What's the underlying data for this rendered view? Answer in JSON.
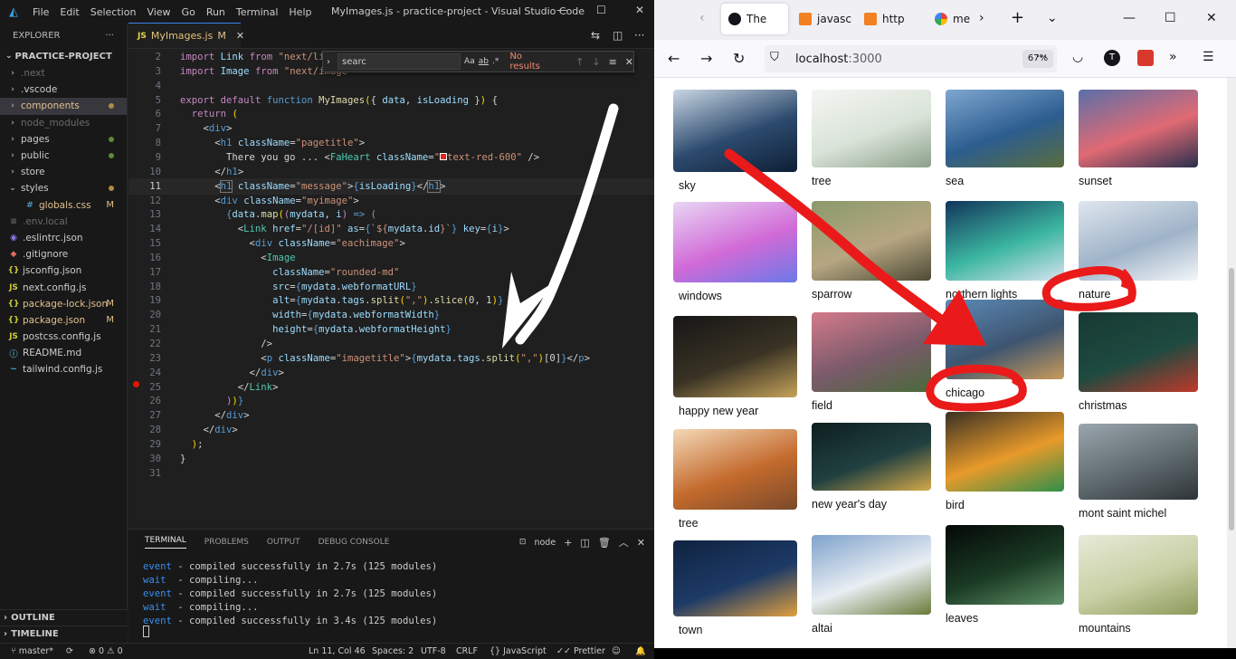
{
  "vscode": {
    "menu": [
      "File",
      "Edit",
      "Selection",
      "View",
      "Go",
      "Run",
      "Terminal",
      "Help"
    ],
    "window_title": "MyImages.js - practice-project - Visual Studio Code",
    "explorer": {
      "header": "EXPLORER",
      "project": "PRACTICE-PROJECT",
      "items": [
        {
          "label": ".next",
          "type": "folder",
          "dim": true
        },
        {
          "label": ".vscode",
          "type": "folder"
        },
        {
          "label": "components",
          "type": "folder",
          "selected": true
        },
        {
          "label": "node_modules",
          "type": "folder",
          "dim": true
        },
        {
          "label": "pages",
          "type": "folder"
        },
        {
          "label": "public",
          "type": "folder"
        },
        {
          "label": "store",
          "type": "folder"
        },
        {
          "label": "styles",
          "type": "folder-open"
        },
        {
          "label": "globals.css",
          "type": "css",
          "badge": "M"
        },
        {
          "label": ".env.local",
          "type": "file",
          "dim": true
        },
        {
          "label": ".eslintrc.json",
          "type": "eslint"
        },
        {
          "label": ".gitignore",
          "type": "git"
        },
        {
          "label": "jsconfig.json",
          "type": "json"
        },
        {
          "label": "next.config.js",
          "type": "js"
        },
        {
          "label": "package-lock.json",
          "type": "json",
          "badge": "M"
        },
        {
          "label": "package.json",
          "type": "json",
          "badge": "M"
        },
        {
          "label": "postcss.config.js",
          "type": "js"
        },
        {
          "label": "README.md",
          "type": "info"
        },
        {
          "label": "tailwind.config.js",
          "type": "tw"
        }
      ],
      "outline": "OUTLINE",
      "timeline": "TIMELINE"
    },
    "tab": {
      "label": "MyImages.js",
      "modified": "M"
    },
    "find": {
      "value": "searc",
      "opts": [
        "Aa",
        "ab",
        ".*"
      ],
      "result": "No results"
    },
    "code_lines": [
      {
        "n": "2",
        "html": "<span class=\"kw\">import</span> <span class=\"var\">Link</span> <span class=\"kw\">from</span> <span class=\"str\">\"next/link\"</span>"
      },
      {
        "n": "3",
        "html": "<span class=\"kw\">import</span> <span class=\"var\">Image</span> <span class=\"kw\">from</span> <span class=\"str\">\"next/image\"</span>"
      },
      {
        "n": "4",
        "html": ""
      },
      {
        "n": "5",
        "html": "<span class=\"kw\">export</span> <span class=\"kw\">default</span> <span class=\"kw2\">function</span> <span class=\"fn\">MyImages</span><span class=\"br\">(</span><span class=\"pun\">{ </span><span class=\"var\">data</span>, <span class=\"var\">isLoading</span><span class=\"pun\"> }</span><span class=\"br\">)</span> <span class=\"pun\">{</span>"
      },
      {
        "n": "6",
        "html": "  <span class=\"kw\">return</span> <span class=\"br\">(</span>"
      },
      {
        "n": "7",
        "html": "    <span class=\"pun\">&lt;</span><span class=\"tag\">div</span><span class=\"pun\">&gt;</span>"
      },
      {
        "n": "8",
        "html": "      <span class=\"pun\">&lt;</span><span class=\"tag\">h1</span> <span class=\"attr\">className</span>=<span class=\"str\">\"pagetitle\"</span><span class=\"pun\">&gt;</span>"
      },
      {
        "n": "9",
        "html": "        There you go ... <span class=\"pun\">&lt;</span><span class=\"cmp\">FaHeart</span> <span class=\"attr\">className</span>=<span class=\"str\">\"<span style=\"display:inline-block;width:8px;height:8px;background:#dc2626;border:1px solid #fff;\"></span>text-red-600\"</span> <span class=\"pun\">/&gt;</span>"
      },
      {
        "n": "10",
        "html": "      <span class=\"pun\">&lt;/</span><span class=\"tag\">h1</span><span class=\"pun\">&gt;</span>"
      },
      {
        "n": "11",
        "html": "      <span class=\"pun\">&lt;</span><span class=\"tag\" style=\"outline:1px solid #777;\">h1</span> <span class=\"attr\">className</span>=<span class=\"str\">\"message\"</span><span class=\"pun\">&gt;</span><span class=\"kw2\">{</span><span class=\"var\">isLoading</span><span class=\"kw2\">}</span><span class=\"pun\">&lt;/</span><span class=\"tag\" style=\"outline:1px solid #777;\">h1</span><span class=\"pun\">&gt;</span>",
        "active": true
      },
      {
        "n": "12",
        "html": "      <span class=\"pun\">&lt;</span><span class=\"tag\">div</span> <span class=\"attr\">className</span>=<span class=\"str\">\"myimage\"</span><span class=\"pun\">&gt;</span>"
      },
      {
        "n": "13",
        "html": "        <span class=\"kw2\">{</span><span class=\"var\">data</span>.<span class=\"fn\">map</span><span class=\"br\">(</span><span class=\"kw\">(</span><span class=\"var\">mydata</span>, <span class=\"var\">i</span><span class=\"kw\">)</span> <span class=\"kw2\">=&gt;</span> <span class=\"kw\">(</span>"
      },
      {
        "n": "14",
        "html": "          <span class=\"pun\">&lt;</span><span class=\"cmp\">Link</span> <span class=\"attr\">href</span>=<span class=\"str\">\"/[id]\"</span> <span class=\"attr\">as</span>=<span class=\"kw2\">{</span><span class=\"str\">`${</span><span class=\"var\">mydata</span>.<span class=\"var\">id</span><span class=\"str\">}`</span><span class=\"kw2\">}</span> <span class=\"attr\">key</span>=<span class=\"kw2\">{</span><span class=\"var\">i</span><span class=\"kw2\">}</span><span class=\"pun\">&gt;</span>"
      },
      {
        "n": "15",
        "html": "            <span class=\"pun\">&lt;</span><span class=\"tag\">div</span> <span class=\"attr\">className</span>=<span class=\"str\">\"eachimage\"</span><span class=\"pun\">&gt;</span>"
      },
      {
        "n": "16",
        "html": "              <span class=\"pun\">&lt;</span><span class=\"cmp\">Image</span>"
      },
      {
        "n": "17",
        "html": "                <span class=\"attr\">className</span>=<span class=\"str\">\"rounded-md\"</span>"
      },
      {
        "n": "18",
        "html": "                <span class=\"attr\">src</span>=<span class=\"kw2\">{</span><span class=\"var\">mydata</span>.<span class=\"var\">webformatURL</span><span class=\"kw2\">}</span>"
      },
      {
        "n": "19",
        "html": "                <span class=\"attr\">alt</span>=<span class=\"kw2\">{</span><span class=\"var\">mydata</span>.<span class=\"var\">tags</span>.<span class=\"fn\">split</span><span class=\"br\">(</span><span class=\"str\">\",\"</span><span class=\"br\">)</span>.<span class=\"fn\">slice</span><span class=\"br\">(</span>0, 1<span class=\"br\">)</span><span class=\"kw2\">}</span>"
      },
      {
        "n": "20",
        "html": "                <span class=\"attr\">width</span>=<span class=\"kw2\">{</span><span class=\"var\">mydata</span>.<span class=\"var\">webformatWidth</span><span class=\"kw2\">}</span>"
      },
      {
        "n": "21",
        "html": "                <span class=\"attr\">height</span>=<span class=\"kw2\">{</span><span class=\"var\">mydata</span>.<span class=\"var\">webformatHeight</span><span class=\"kw2\">}</span>"
      },
      {
        "n": "22",
        "html": "              <span class=\"pun\">/&gt;</span>"
      },
      {
        "n": "23",
        "html": "              <span class=\"pun\">&lt;</span><span class=\"tag\">p</span> <span class=\"attr\">className</span>=<span class=\"str\">\"imagetitle\"</span><span class=\"pun\">&gt;</span><span class=\"kw2\">{</span><span class=\"var\">mydata</span>.<span class=\"var\">tags</span>.<span class=\"fn\">split</span><span class=\"br\">(</span><span class=\"str\">\",\"</span><span class=\"br\">)</span>[0]<span class=\"kw2\">}</span><span class=\"pun\">&lt;/</span><span class=\"tag\">p</span><span class=\"pun\">&gt;</span>"
      },
      {
        "n": "24",
        "html": "            <span class=\"pun\">&lt;/</span><span class=\"tag\">div</span><span class=\"pun\">&gt;</span>"
      },
      {
        "n": "25",
        "html": "          <span class=\"pun\">&lt;/</span><span class=\"cmp\">Link</span><span class=\"pun\">&gt;</span>"
      },
      {
        "n": "26",
        "html": "        <span class=\"kw\">)</span><span class=\"br\">)</span><span class=\"kw2\">}</span>"
      },
      {
        "n": "27",
        "html": "      <span class=\"pun\">&lt;/</span><span class=\"tag\">div</span><span class=\"pun\">&gt;</span>"
      },
      {
        "n": "28",
        "html": "    <span class=\"pun\">&lt;/</span><span class=\"tag\">div</span><span class=\"pun\">&gt;</span>"
      },
      {
        "n": "29",
        "html": "  <span class=\"br\">)</span>;"
      },
      {
        "n": "30",
        "html": "<span class=\"pun\">}</span>"
      },
      {
        "n": "31",
        "html": ""
      }
    ],
    "panel": {
      "tabs": [
        "TERMINAL",
        "PROBLEMS",
        "OUTPUT",
        "DEBUG CONSOLE"
      ],
      "shell": "node",
      "lines": [
        {
          "label": "event",
          "text": " - compiled successfully in 2.7s (125 modules)"
        },
        {
          "label": "wait",
          "text": "  - compiling..."
        },
        {
          "label": "event",
          "text": " - compiled successfully in 2.7s (125 modules)"
        },
        {
          "label": "wait",
          "text": "  - compiling..."
        },
        {
          "label": "event",
          "text": " - compiled successfully in 3.4s (125 modules)"
        }
      ]
    },
    "status": {
      "branch": "master*",
      "problems": "⊗ 0 ⚠ 0",
      "position": "Ln 11, Col 46",
      "spaces": "Spaces: 2",
      "encoding": "UTF-8",
      "eol": "CRLF",
      "language": "{} JavaScript",
      "formatter": "✓✓ Prettier"
    }
  },
  "browser": {
    "tabs": [
      {
        "label": "The",
        "active": true
      },
      {
        "label": "javasc"
      },
      {
        "label": "http"
      },
      {
        "label": "me"
      }
    ],
    "url": {
      "host": "localhost",
      "port": ":3000"
    },
    "zoom": "67%",
    "profile_letter": "T",
    "gallery": [
      {
        "caption": "sky",
        "col": 0,
        "row": 0,
        "colors": [
          "#c9d6e3",
          "#2c4a6e",
          "#0e1f36"
        ]
      },
      {
        "caption": "tree",
        "col": 1,
        "row": 0,
        "colors": [
          "#f4f6f2",
          "#d9e3d8",
          "#8ba08a"
        ]
      },
      {
        "caption": "sea",
        "col": 2,
        "row": 0,
        "colors": [
          "#7fa7d1",
          "#2c5d8f",
          "#5a6d3e"
        ]
      },
      {
        "caption": "sunset",
        "col": 3,
        "row": 0,
        "colors": [
          "#5b6fa8",
          "#e06a74",
          "#2a2f4d"
        ]
      },
      {
        "caption": "windows",
        "col": 0,
        "row": 1,
        "colors": [
          "#e8d6f4",
          "#d16ad7",
          "#6b79e8"
        ]
      },
      {
        "caption": "sparrow",
        "col": 1,
        "row": 1,
        "colors": [
          "#8a9a6a",
          "#b6a682",
          "#4d4a35"
        ]
      },
      {
        "caption": "northern lights",
        "col": 2,
        "row": 1,
        "colors": [
          "#12355a",
          "#3bb6a0",
          "#d8e3ef"
        ]
      },
      {
        "caption": "nature",
        "col": 3,
        "row": 1,
        "colors": [
          "#dfe6ee",
          "#9fb3c8",
          "#f3f6f9"
        ]
      },
      {
        "caption": "happy new year",
        "col": 0,
        "row": 2,
        "colors": [
          "#161616",
          "#3a3324",
          "#c6a35a"
        ]
      },
      {
        "caption": "field",
        "col": 1,
        "row": 2,
        "colors": [
          "#d47a8a",
          "#7a5a6a",
          "#4a6a3a"
        ]
      },
      {
        "caption": "chicago",
        "col": 2,
        "row": 2,
        "colors": [
          "#5c8ab6",
          "#3d5570",
          "#c99a5a"
        ]
      },
      {
        "caption": "christmas",
        "col": 3,
        "row": 2,
        "colors": [
          "#173a33",
          "#1e4a40",
          "#c0392b"
        ]
      },
      {
        "caption": "tree",
        "col": 0,
        "row": 3,
        "colors": [
          "#f4d9b8",
          "#c46a2d",
          "#7a4a2a"
        ]
      },
      {
        "caption": "new year's day",
        "col": 1,
        "row": 3,
        "colors": [
          "#0d1f1f",
          "#214040",
          "#d4a94a"
        ]
      },
      {
        "caption": "bird",
        "col": 2,
        "row": 3,
        "colors": [
          "#3a3024",
          "#e89a2a",
          "#2f8f4a"
        ]
      },
      {
        "caption": "mont saint michel",
        "col": 3,
        "row": 3,
        "colors": [
          "#9aa6ae",
          "#5f6a6e",
          "#2e3438"
        ]
      },
      {
        "caption": "town",
        "col": 0,
        "row": 4,
        "colors": [
          "#0f2340",
          "#1d3a66",
          "#e0a040"
        ]
      },
      {
        "caption": "altai",
        "col": 1,
        "row": 4,
        "colors": [
          "#7ea2cc",
          "#e9eef3",
          "#6a7a3a"
        ]
      },
      {
        "caption": "leaves",
        "col": 2,
        "row": 4,
        "colors": [
          "#050806",
          "#1a3a24",
          "#5d8f64"
        ]
      },
      {
        "caption": "mountains",
        "col": 3,
        "row": 4,
        "colors": [
          "#e7ead8",
          "#c9cfa4",
          "#8a9a5a"
        ]
      }
    ]
  }
}
